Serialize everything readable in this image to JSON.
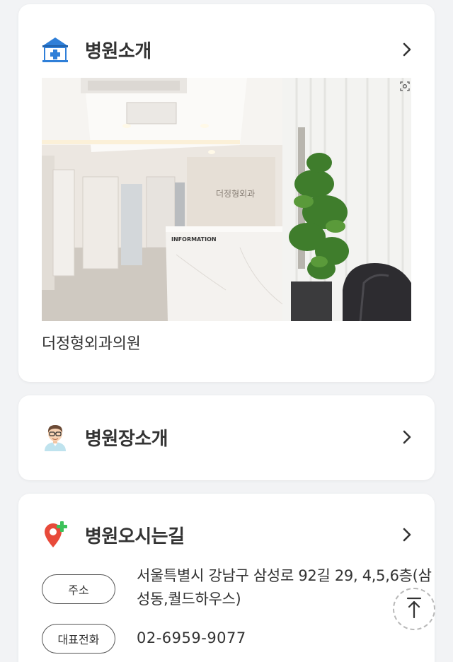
{
  "intro": {
    "title": "병원소개",
    "icon": "hospital-icon",
    "photo_sign": "INFORMATION",
    "photo_logo": "더정형외과",
    "hospital_name": "더정형외과의원"
  },
  "doctor": {
    "title": "병원장소개",
    "icon": "doctor-avatar-icon"
  },
  "directions": {
    "title": "병원오시는길",
    "icon": "location-pin-icon",
    "address_label": "주소",
    "address_value": "서울특별시 강남구 삼성로 92길 29, 4,5,6층(삼성동,퀄드하우스)",
    "phone_label": "대표전화",
    "phone_value": "02-6959-9077"
  },
  "colors": {
    "background": "#f2f3f5",
    "card": "#ffffff",
    "hospital_icon_blue": "#2f7fd8",
    "pin_red": "#e84a3a",
    "pin_green": "#3cc15a"
  },
  "icons": {
    "chevron": "chevron-right-icon",
    "scroll_top": "arrow-up-icon",
    "zoom": "zoom-icon"
  }
}
